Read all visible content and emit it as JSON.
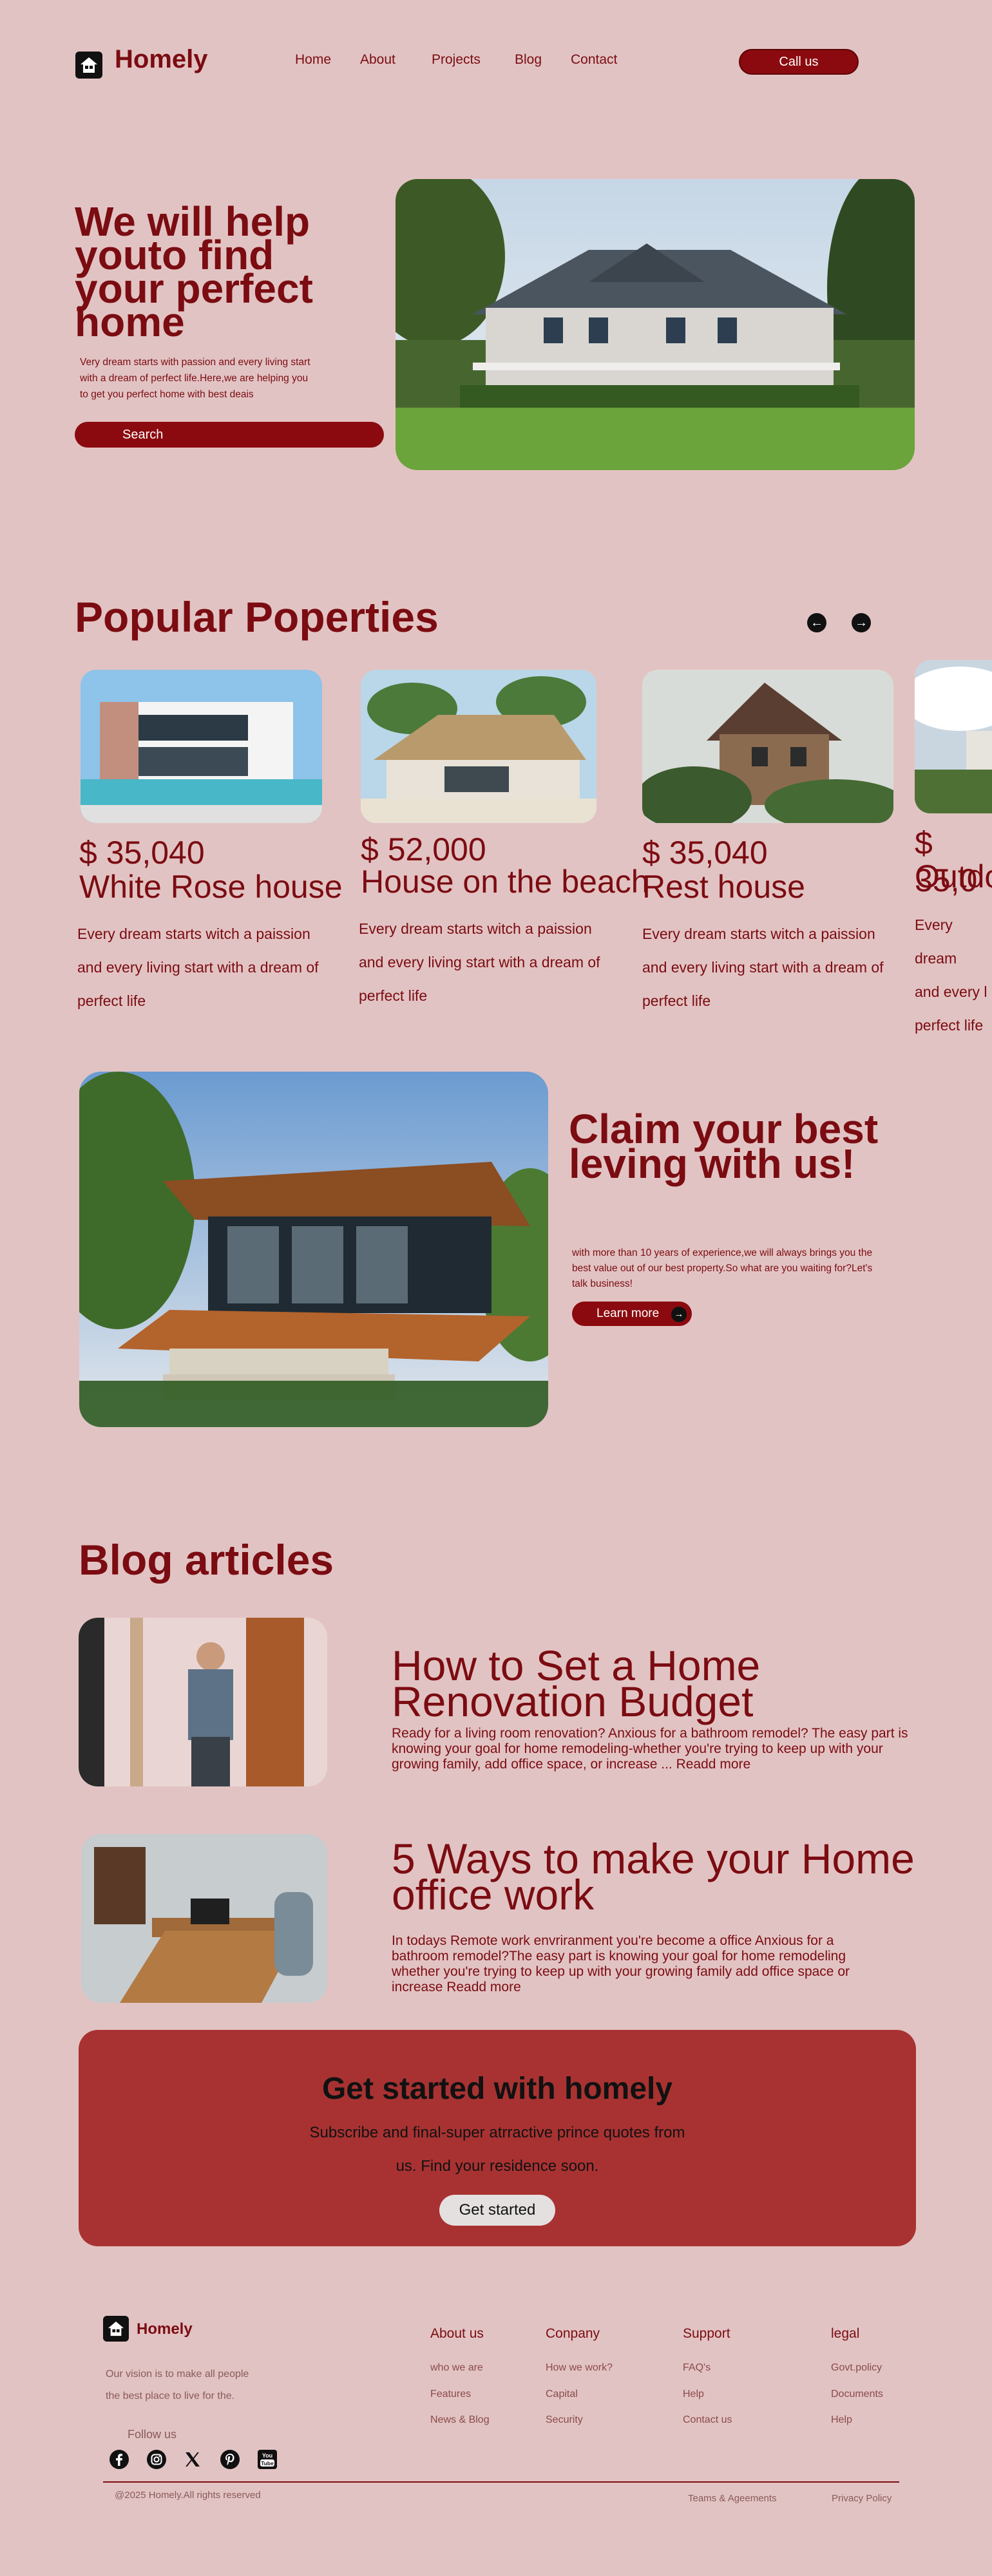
{
  "header": {
    "brand": "Homely",
    "nav": [
      "Home",
      "About",
      "Projects",
      "Blog",
      "Contact"
    ],
    "call_label": "Call us"
  },
  "hero": {
    "title": "We will help youto find your perfect home",
    "description": "Very dream starts with passion and every living start with a dream of perfect life.Here,we are helping you to get you perfect home with best deais",
    "search_label": "Search"
  },
  "popular": {
    "title": "Popular Poperties",
    "cards": [
      {
        "price": "$ 35,040",
        "name": "White Rose house",
        "desc": "Every dream starts witch a paission\nand  every living start with a dream of\nperfect life"
      },
      {
        "price": "$ 52,000",
        "name": "House on the beach",
        "desc": "Every dream starts witch a paission\nand  every living start with a dream of\nperfect life"
      },
      {
        "price": "$ 35,040",
        "name": "Rest house",
        "desc": "Every dream starts witch a paission\nand  every living start with a dream of\nperfect life"
      },
      {
        "price": "$ 35,0",
        "name": "Outdo",
        "desc": "Every dream\nand  every l\nperfect life"
      }
    ]
  },
  "claim": {
    "title": "Claim your best leving with us!",
    "description": "with more than 10 years of experience,we will always brings you the best value out of our best property.So what are you waiting for?Let's talk business!",
    "learn_label": "Learn more"
  },
  "blog": {
    "title": "Blog articles",
    "articles": [
      {
        "title": "How to Set a Home Renovation Budget",
        "desc": "Ready for a living room renovation? Anxious for a bathroom remodel? The easy part is knowing your goal for home remodeling-whether you're trying to keep  up with your growing family, add office space, or increase ...  Readd more"
      },
      {
        "title": "5 Ways to make your Home office work",
        "desc": "In todays Remote work envriranment you're become a office Anxious for a bathroom remodel?The easy part is knowing your goal for home remodeling whether you're trying to keep up with your growing family add office space or increase Readd more"
      }
    ]
  },
  "cta": {
    "title": "Get started with homely",
    "subtitle_line1": "Subscribe and final-super atrractive prince quotes from",
    "subtitle_line2": "us. Find your residence soon.",
    "button": "Get started"
  },
  "footer": {
    "brand": "Homely",
    "vision_line1": "Our vision is to make all people",
    "vision_line2": "the best place to live for the.",
    "follow": "Follow us",
    "columns": [
      {
        "head": "About us",
        "links": [
          "who we are",
          "Features",
          "News & Blog"
        ]
      },
      {
        "head": "Conpany",
        "links": [
          "How we work?",
          "Capital",
          "Security"
        ]
      },
      {
        "head": "Support",
        "links": [
          "FAQ's",
          "Help",
          "Contact us"
        ]
      },
      {
        "head": "legal",
        "links": [
          "Govt.policy",
          "Documents",
          "Help"
        ]
      }
    ],
    "copyright": "@2025 Homely.All rights reserved",
    "terms": "Teams & Ageements",
    "privacy": "Privacy Policy"
  },
  "colors": {
    "background": "#e2c3c3",
    "brand": "#7b0c12",
    "button": "#8b0a0f",
    "cta": "#a83232"
  }
}
